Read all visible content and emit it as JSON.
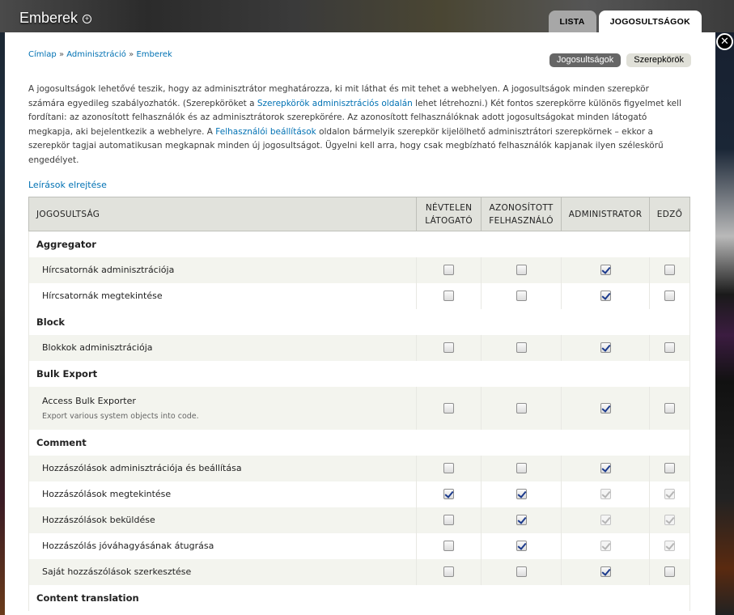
{
  "site": {
    "title": "Emberek"
  },
  "top_tabs": [
    "LISTA",
    "JOGOSULTSÁGOK"
  ],
  "breadcrumb": {
    "home": "Címlap",
    "admin": "Adminisztráció",
    "people": "Emberek",
    "sep": "»"
  },
  "secondary_tabs": [
    "Jogosultságok",
    "Szerepkörök"
  ],
  "description": {
    "part1": "A jogosultságok lehetővé teszik, hogy az adminisztrátor meghatározza, ki mit láthat és mit tehet a webhelyen. A jogosultságok minden szerepkör számára egyedileg szabályozhatók. (Szerepköröket a ",
    "link1": "Szerepkörök adminisztrációs oldalán",
    "part2": " lehet létrehozni.) Két fontos szerepkörre különös figyelmet kell fordítani: az azonosított felhasználók és az adminisztrátorok szerepkörére. Az azonosított felhasználóknak adott jogosultságokat minden látogató megkapja, aki bejelentkezik a webhelyre. A ",
    "link2": "Felhasználói beállítások",
    "part3": " oldalon bármelyik szerepkör kijelölhető adminisztrátori szerepkörnek – ekkor a szerepkör tagjai automatikusan megkapnak minden új jogosultságot. Ügyelni kell arra, hogy csak megbízható felhasználók kapjanak ilyen széleskörű engedélyet."
  },
  "hide_descriptions": "Leírások elrejtése",
  "table": {
    "headers": [
      "JOGOSULTSÁG",
      "NÉVTELEN LÁTOGATÓ",
      "AZONOSÍTOTT FELHASZNÁLÓ",
      "ADMINISTRATOR",
      "EDZŐ"
    ],
    "modules": [
      {
        "name": "Aggregator",
        "rows": [
          {
            "label": "Hírcsatornák adminisztrációja",
            "checks": [
              "off",
              "off",
              "on",
              "off"
            ]
          },
          {
            "label": "Hírcsatornák megtekintése",
            "checks": [
              "off",
              "off",
              "on",
              "off"
            ]
          }
        ]
      },
      {
        "name": "Block",
        "rows": [
          {
            "label": "Blokkok adminisztrációja",
            "checks": [
              "off",
              "off",
              "on",
              "off"
            ]
          }
        ]
      },
      {
        "name": "Bulk Export",
        "rows": [
          {
            "label": "Access Bulk Exporter",
            "desc": "Export various system objects into code.",
            "checks": [
              "off",
              "off",
              "on",
              "off"
            ]
          }
        ]
      },
      {
        "name": "Comment",
        "rows": [
          {
            "label": "Hozzászólások adminisztrációja és beállítása",
            "checks": [
              "off",
              "off",
              "on",
              "off"
            ]
          },
          {
            "label": "Hozzászólások megtekintése",
            "checks": [
              "on",
              "on",
              "disabled",
              "disabled"
            ]
          },
          {
            "label": "Hozzászólások beküldése",
            "checks": [
              "off",
              "on",
              "disabled",
              "disabled"
            ]
          },
          {
            "label": "Hozzászólás jóváhagyásának átugrása",
            "checks": [
              "off",
              "on",
              "disabled",
              "disabled"
            ]
          },
          {
            "label": "Saját hozzászólások szerkesztése",
            "checks": [
              "off",
              "off",
              "on",
              "off"
            ]
          }
        ]
      },
      {
        "name": "Content translation",
        "rows": []
      }
    ]
  }
}
